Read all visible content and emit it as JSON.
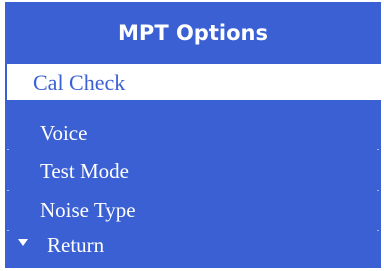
{
  "menu": {
    "title": "MPT Options",
    "selected_item": "Cal Check",
    "items": [
      "Voice",
      "Test Mode",
      "Noise Type",
      "Return"
    ]
  },
  "icons": {
    "return": "triangle-down-icon"
  },
  "colors": {
    "background": "#3a60d3",
    "highlight": "#ffffff",
    "text": "#ffffff",
    "selected_text": "#3a60d3"
  }
}
